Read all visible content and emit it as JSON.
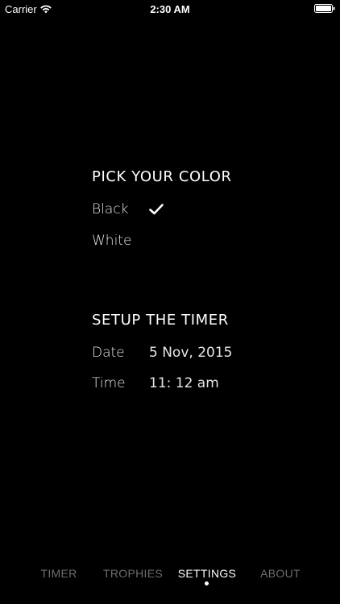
{
  "status_bar": {
    "carrier": "Carrier",
    "time": "2:30 AM",
    "icons": [
      "wifi-icon",
      "battery-icon"
    ]
  },
  "color_section": {
    "heading": "PICK YOUR COLOR",
    "options": [
      {
        "label": "Black",
        "selected": true
      },
      {
        "label": "White",
        "selected": false
      }
    ]
  },
  "timer_section": {
    "heading": "SETUP THE TIMER",
    "date_label": "Date",
    "date_value": "5 Nov, 2015",
    "time_label": "Time",
    "time_value": "11: 12 am"
  },
  "tabbar": {
    "tabs": [
      {
        "label": "TIMER",
        "active": false
      },
      {
        "label": "TROPHIES",
        "active": false
      },
      {
        "label": "SETTINGS",
        "active": true
      },
      {
        "label": "ABOUT",
        "active": false
      }
    ]
  },
  "colors": {
    "background": "#000000",
    "text": "#ffffff",
    "inactive_tab": "#6d6d6d"
  }
}
